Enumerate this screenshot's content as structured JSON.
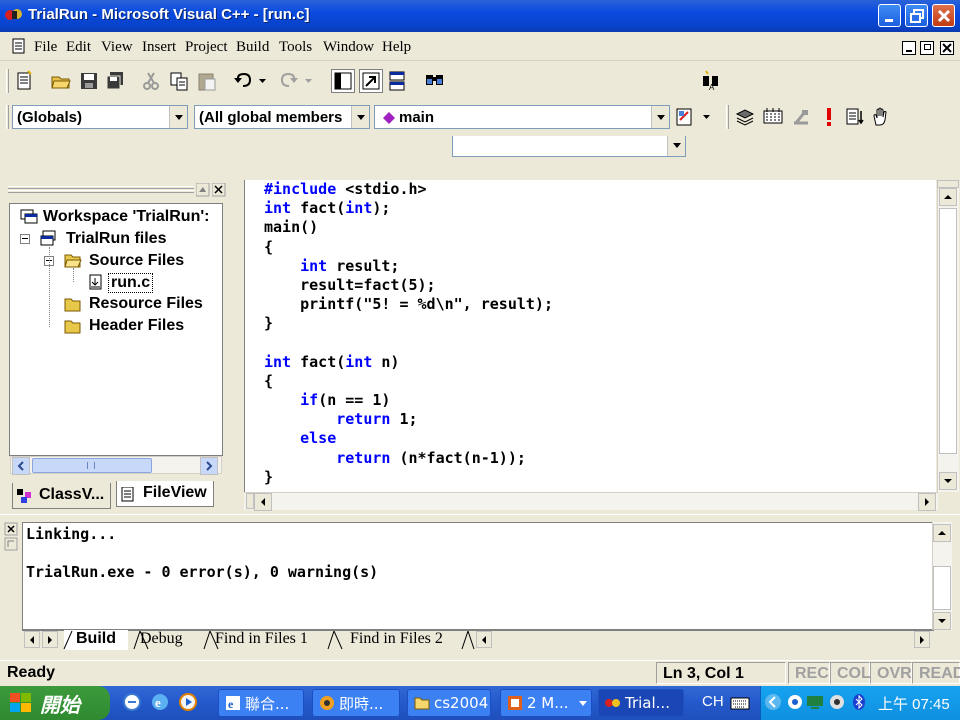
{
  "window": {
    "title": "TrialRun - Microsoft Visual C++ - [run.c]"
  },
  "menu": [
    {
      "label": "File"
    },
    {
      "label": "Edit"
    },
    {
      "label": "View"
    },
    {
      "label": "Insert"
    },
    {
      "label": "Project"
    },
    {
      "label": "Build"
    },
    {
      "label": "Tools"
    },
    {
      "label": "Window"
    },
    {
      "label": "Help"
    }
  ],
  "wizardbar": {
    "scope": "(Globals)",
    "members": "(All global members",
    "function": "main"
  },
  "workspace": {
    "tree": [
      {
        "label": "Workspace 'TrialRun':"
      },
      {
        "label": "TrialRun files"
      },
      {
        "label": "Source Files"
      },
      {
        "label": "run.c"
      },
      {
        "label": "Resource Files"
      },
      {
        "label": "Header Files"
      }
    ],
    "tabs": [
      {
        "label": "ClassV..."
      },
      {
        "label": "FileView"
      }
    ]
  },
  "editor": {
    "lines": [
      "#include <stdio.h>",
      "int fact(int);",
      "main()",
      "{",
      "    int result;",
      "    result=fact(5);",
      "    printf(\"5! = %d\\n\", result);",
      "}",
      "",
      "int fact(int n)",
      "{",
      "    if(n == 1)",
      "        return 1;",
      "    else",
      "        return (n*fact(n-1));",
      "}"
    ]
  },
  "output": {
    "lines": [
      "Linking...",
      "",
      "TrialRun.exe - 0 error(s), 0 warning(s)"
    ],
    "tabs": [
      {
        "label": "Build"
      },
      {
        "label": "Debug"
      },
      {
        "label": "Find in Files 1"
      },
      {
        "label": "Find in Files 2"
      }
    ]
  },
  "status": {
    "text": "Ready",
    "position": "Ln 3, Col 1",
    "rec": "REC",
    "col": "COL",
    "ovr": "OVR",
    "read": "READ"
  },
  "taskbar": {
    "start": "開始",
    "tasks": [
      {
        "label": "聯合..."
      },
      {
        "label": "即時..."
      },
      {
        "label": "cs2004"
      },
      {
        "label": "2 M..."
      },
      {
        "label": "Trial..."
      }
    ],
    "lang": "CH",
    "clock": "上午 07:45"
  },
  "colors": {
    "keyword": "#0000ff",
    "titlebar": "#0a4ae0",
    "taskbar": "#245edb"
  }
}
